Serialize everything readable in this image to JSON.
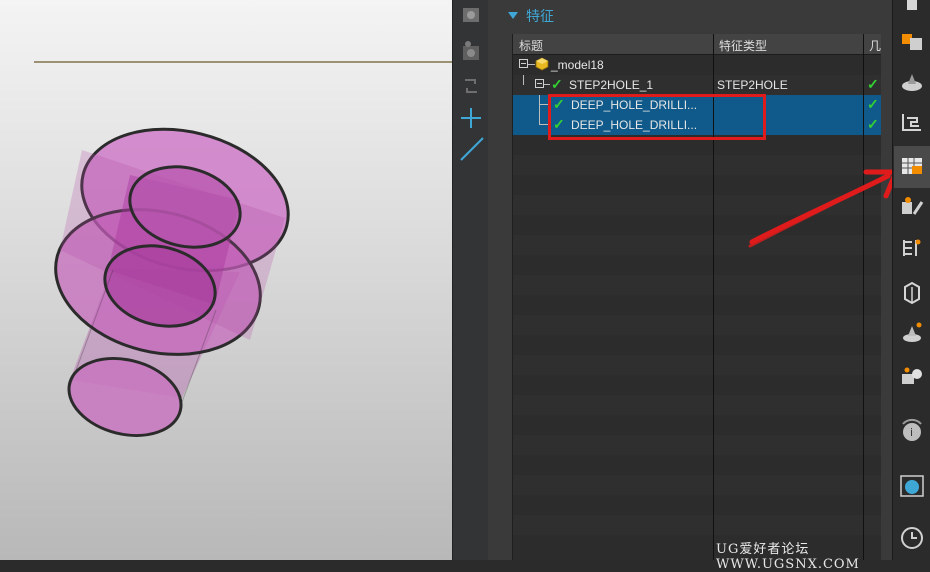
{
  "panel": {
    "section_title": "特征",
    "columns": {
      "title": "标题",
      "type": "特征类型",
      "extra": "几"
    }
  },
  "tree": {
    "root": {
      "label": "_model18",
      "type": ""
    },
    "parent": {
      "label": "STEP2HOLE_1",
      "type": "STEP2HOLE"
    },
    "children": [
      {
        "label": "DEEP_HOLE_DRILLI...",
        "type": ""
      },
      {
        "label": "DEEP_HOLE_DRILLI...",
        "type": ""
      }
    ]
  },
  "watermark": "UG爱好者论坛 WWW.UGSNX.COM",
  "colors": {
    "accent": "#3fa7d6",
    "selection": "#0f5a8a",
    "check": "#33d133",
    "highlight_box": "#e01b1b",
    "arrow": "#e01b1b",
    "model": "#c05fb6"
  }
}
